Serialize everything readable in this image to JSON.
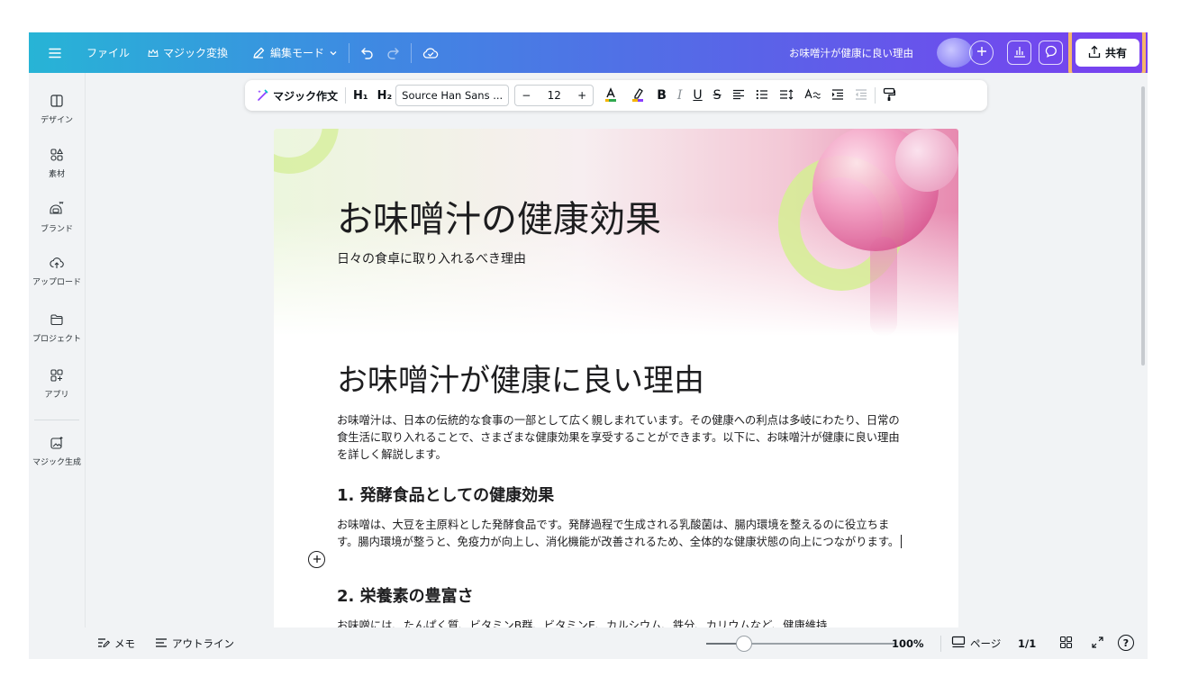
{
  "topbar": {
    "menu_icon": "hamburger-icon",
    "file_label": "ファイル",
    "magic_switch_label": "マジック変換",
    "edit_mode_label": "編集モード",
    "doc_title": "お味噌汁が健康に良い理由",
    "share_label": "共有"
  },
  "sidebar": {
    "items": [
      {
        "label": "デザイン",
        "icon": "design-icon"
      },
      {
        "label": "素材",
        "icon": "elements-icon"
      },
      {
        "label": "ブランド",
        "icon": "brand-icon"
      },
      {
        "label": "アップロード",
        "icon": "upload-icon"
      },
      {
        "label": "プロジェクト",
        "icon": "folder-icon"
      },
      {
        "label": "アプリ",
        "icon": "apps-icon"
      },
      {
        "label": "マジック生成",
        "icon": "magic-media-icon"
      }
    ]
  },
  "text_toolbar": {
    "magic_write_label": "マジック作文",
    "h1_label": "H₁",
    "h2_label": "H₂",
    "font_name": "Source Han Sans ...",
    "font_size": "12",
    "minus": "−",
    "plus": "+",
    "bold": "B",
    "italic": "I",
    "underline": "U",
    "strike": "S"
  },
  "page": {
    "hero_title": "お味噌汁の健康効果",
    "hero_subtitle": "日々の食卓に取り入れるべき理由",
    "heading": "お味噌汁が健康に良い理由",
    "intro": "お味噌汁は、日本の伝統的な食事の一部として広く親しまれています。その健康への利点は多岐にわたり、日常の食生活に取り入れることで、さまざまな健康効果を享受することができます。以下に、お味噌汁が健康に良い理由を詳しく解説します。",
    "section1_title": "1. 発酵食品としての健康効果",
    "section1_body": "お味噌は、大豆を主原料とした発酵食品です。発酵過程で生成される乳酸菌は、腸内環境を整えるのに役立ちます。腸内環境が整うと、免疫力が向上し、消化機能が改善されるため、全体的な健康状態の向上につながります。",
    "section2_title": "2. 栄養素の豊富さ",
    "section2_body_partial": "お味噌には、たんぱく質、ビタミンB群、ビタミンE、カルシウム、鉄分、カリウムなど、健康維持"
  },
  "bottombar": {
    "notes_label": "メモ",
    "outline_label": "アウトライン",
    "zoom_value": 20,
    "zoom_label": "100%",
    "pages_label": "ページ",
    "page_count": "1/1",
    "help_label": "?"
  },
  "colors": {
    "share_highlight": "#f6b66b",
    "topbar_start": "#27b4d6",
    "topbar_end": "#7a3ff0"
  }
}
